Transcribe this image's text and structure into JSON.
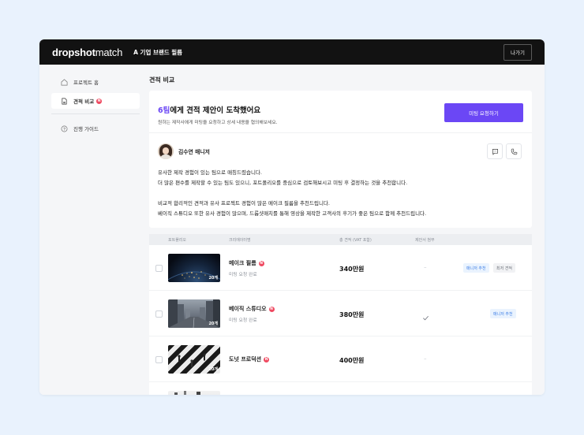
{
  "app": {
    "logo_bold": "dropshot",
    "logo_light": "match",
    "title": "A 기업 브랜드 필름",
    "exit_label": "나가기"
  },
  "sidebar": {
    "items": [
      {
        "label": "프로젝트 홈",
        "icon": "home-icon"
      },
      {
        "label": "견적 비교",
        "icon": "document-icon",
        "badge": "N"
      },
      {
        "label": "진행 가이드",
        "icon": "help-circle-icon"
      }
    ]
  },
  "main": {
    "section_title": "견적 비교"
  },
  "summary": {
    "headline_accent": "6팀",
    "headline_rest": "에게 견적 제안이 도착했어요",
    "subline": "원하는 제작사에게 미팅을 요청하고 상세 내용을 협의해보세요.",
    "cta_label": "미팅 요청하기",
    "manager_name": "김수연 매니저",
    "message_lines": [
      "유사한 제작 경험이 있는 팀으로 매칭드렸습니다.",
      "더 많은 편수를 제작할 수 있는 팀도 있으니, 포트폴리오를 중심으로 검토해보시고 미팅 후 결정하는 것을 추천합니다.",
      "",
      "비교적 합리적인 견적과 유사 프로젝트 경험이 많은 메이크 필름을 추천드립니다.",
      "베이직 스튜디오 또한 유사 경험이 많으며, 드롭샷매치를 통해 영상을 제작한 고객사의 후기가 좋은 팀으로 함께 추천드립니다."
    ]
  },
  "table": {
    "headers": [
      "포트폴리오",
      "크리에이터명",
      "총 견적 (VAT 포함)",
      "제안서 첨부"
    ],
    "rows": [
      {
        "count": "20개",
        "name": "메이크 필름",
        "badge": "N",
        "status": "미팅 요청 완료",
        "price": "340만원",
        "attachment": "–",
        "tags": [
          "매니저 추천",
          "최저 견적"
        ]
      },
      {
        "count": "20개",
        "name": "베이직 스튜디오",
        "badge": "N",
        "status": "미팅 요청 완료",
        "price": "380만원",
        "attachment": "check",
        "tags": [
          "매니저 추천"
        ]
      },
      {
        "count": "20개",
        "name": "도넛 프로덕션",
        "badge": "N",
        "status": "",
        "price": "400만원",
        "attachment": "–",
        "tags": []
      }
    ]
  },
  "colors": {
    "accent": "#6b47f5",
    "badge": "#ef4a61",
    "topbar": "#121212",
    "tag_blue_text": "#3c7ee6"
  }
}
